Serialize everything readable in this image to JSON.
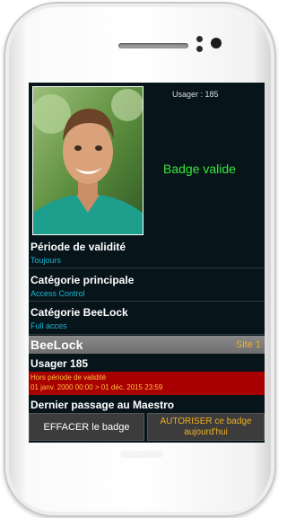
{
  "header": {
    "usager": "Usager : 185"
  },
  "status": {
    "badge": "Badge valide",
    "color": "#39e639"
  },
  "details": [
    {
      "title": "Période de validité",
      "value": "Toujours"
    },
    {
      "title": "Catégorie principale",
      "value": "Access Control"
    },
    {
      "title": "Catégorie BeeLock",
      "value": "Full acces"
    }
  ],
  "section": {
    "title": "BeeLock",
    "site": "Site 1"
  },
  "usager": {
    "label": "Usager 185"
  },
  "warning": {
    "line1": "Hors période de validité",
    "line2": "01 janv. 2000 00:00  > 01 déc. 2015 23:59",
    "bg": "#a80000"
  },
  "last_passage": "Dernier passage au Maestro",
  "actions": {
    "erase": "EFFACER le badge",
    "authorize": "AUTORISER ce badge aujourd'hui"
  }
}
